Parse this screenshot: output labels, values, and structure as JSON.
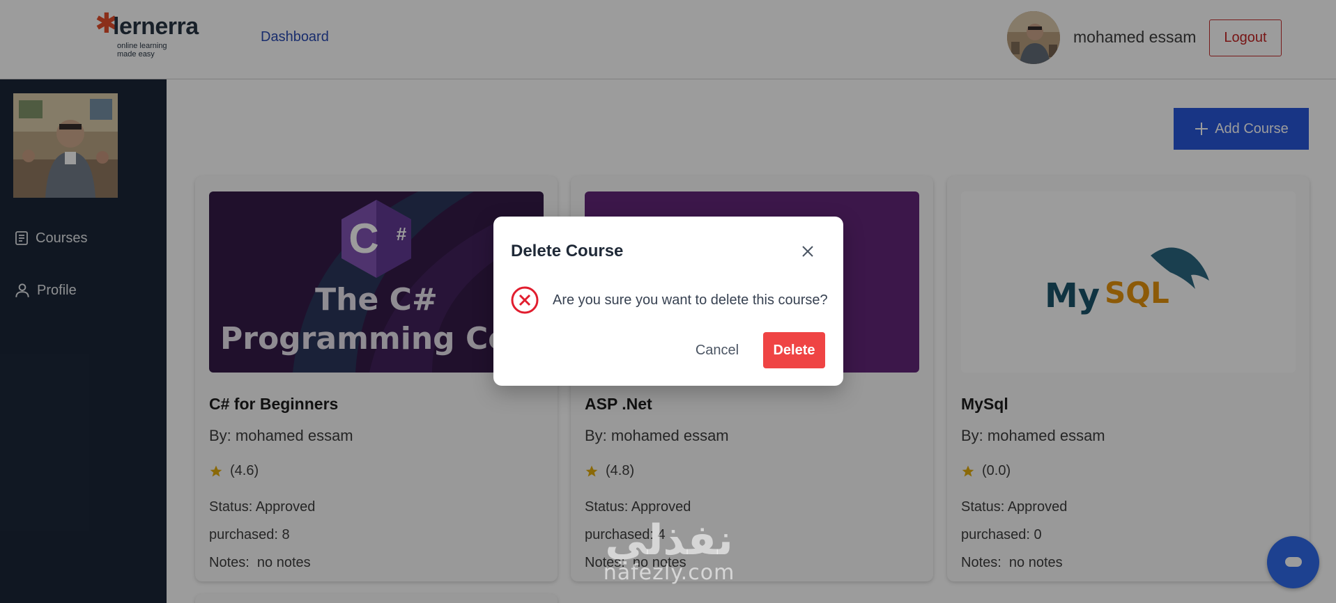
{
  "header": {
    "logo_word": "lernerra",
    "logo_tagline": "online learning made easy",
    "nav_dashboard": "Dashboard",
    "username": "mohamed essam",
    "logout_label": "Logout"
  },
  "sidebar": {
    "items": [
      {
        "label": "Courses",
        "icon": "book-icon"
      },
      {
        "label": "Profile",
        "icon": "user-icon"
      }
    ]
  },
  "main": {
    "add_course_label": "Add Course",
    "courses": [
      {
        "title": "C# for Beginners",
        "by": "By: mohamed essam",
        "rating": "(4.6)",
        "status": "Status: Approved",
        "purchased": "purchased: 8",
        "notes": "Notes:  no notes",
        "thumb_line1": "The C#",
        "thumb_line2": "Programming Cour",
        "thumb_logo": "C#"
      },
      {
        "title": "ASP .Net",
        "by": "By: mohamed essam",
        "rating": "(4.8)",
        "status": "Status: Approved",
        "purchased": "purchased: 4",
        "notes": "Notes:  no notes"
      },
      {
        "title": "MySql",
        "by": "By: mohamed essam",
        "rating": "(0.0)",
        "status": "Status: Approved",
        "purchased": "purchased: 0",
        "notes": "Notes:  no notes",
        "thumb_logo_my": "My",
        "thumb_logo_sql": "SQL"
      }
    ]
  },
  "dialog": {
    "title": "Delete Course",
    "message": "Are you sure you want to delete this course?",
    "cancel_label": "Cancel",
    "delete_label": "Delete"
  },
  "watermark": {
    "arabic": "نفذلي",
    "latin": "nafezly.com"
  },
  "colors": {
    "primary": "#1d4ed8",
    "danger": "#ef4444",
    "sidebar_bg": "#0f1b2d",
    "star": "#e0a800",
    "logout": "#c01818"
  }
}
